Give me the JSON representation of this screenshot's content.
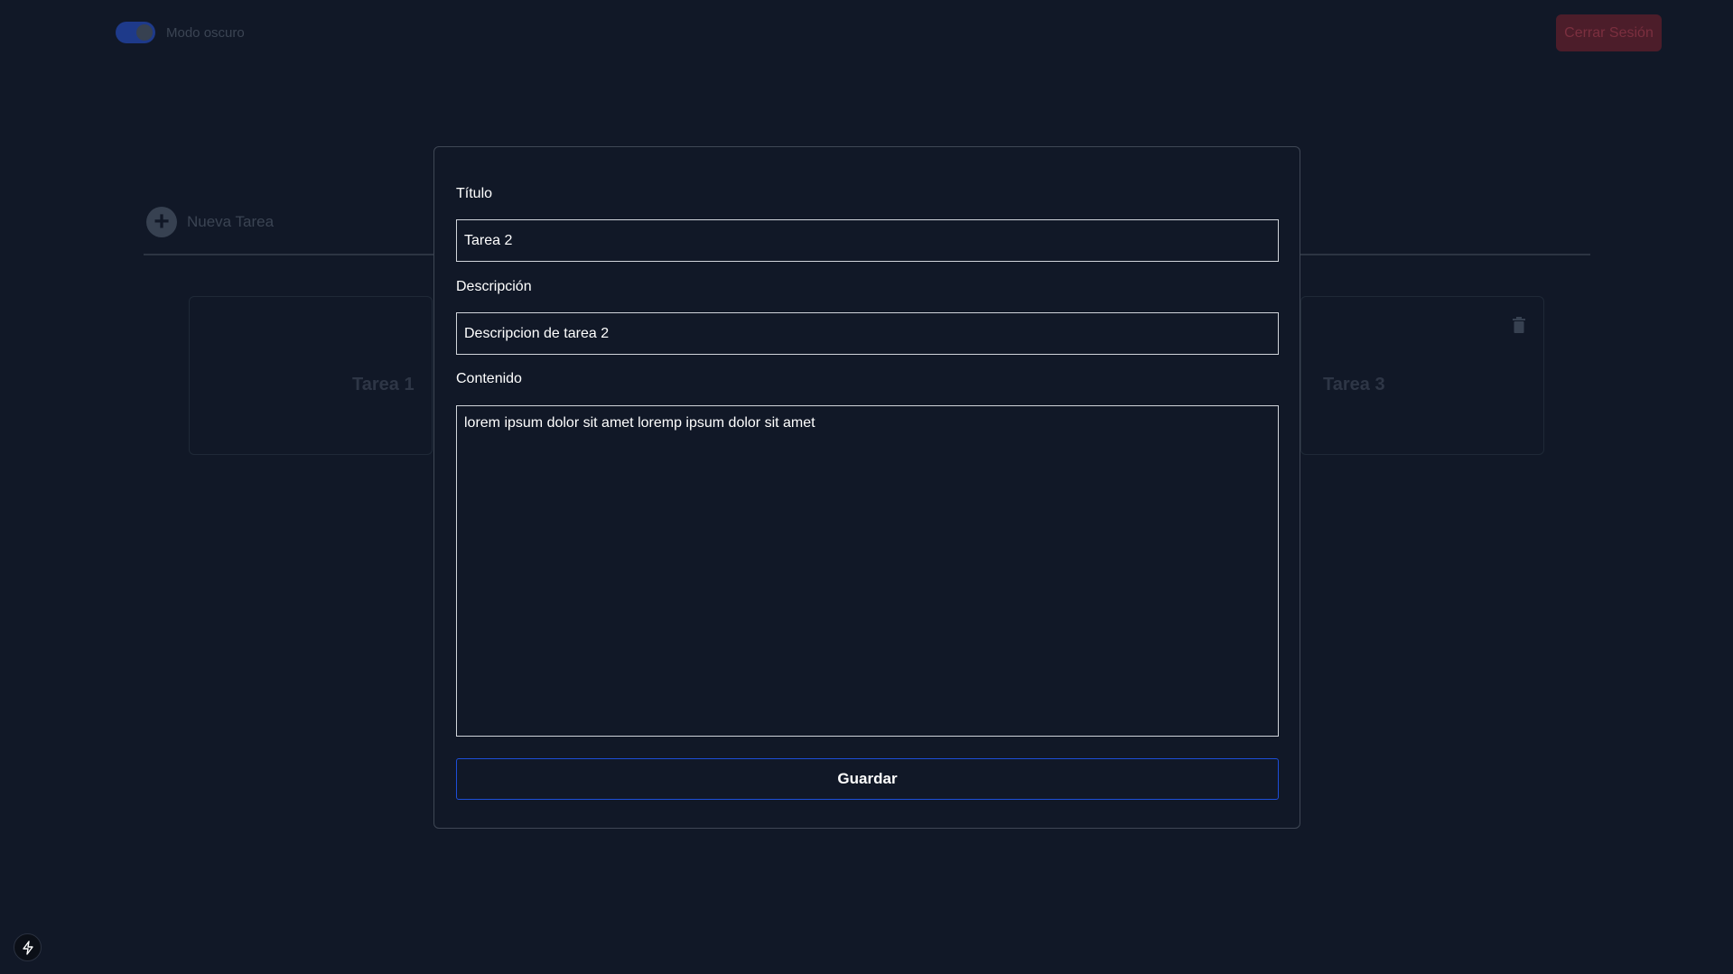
{
  "header": {
    "dark_mode_label": "Modo oscuro",
    "logout_label": "Cerrar Sesión"
  },
  "toolbar": {
    "new_task_label": "Nueva Tarea"
  },
  "tasks": [
    {
      "title": "Tarea 1"
    },
    {
      "title": "Tarea 3"
    }
  ],
  "modal": {
    "title_label": "Título",
    "title_value": "Tarea 2",
    "description_label": "Descripción",
    "description_value": "Descripcion de tarea 2",
    "content_label": "Contenido",
    "content_value": "lorem ipsum dolor sit amet loremp ipsum dolor sit amet",
    "save_label": "Guardar"
  },
  "colors": {
    "background": "#111827",
    "accent": "#1d4ed8",
    "logout": "#4c1d2a"
  },
  "icons": [
    "plus-circle-icon",
    "trash-icon",
    "bolt-icon"
  ]
}
